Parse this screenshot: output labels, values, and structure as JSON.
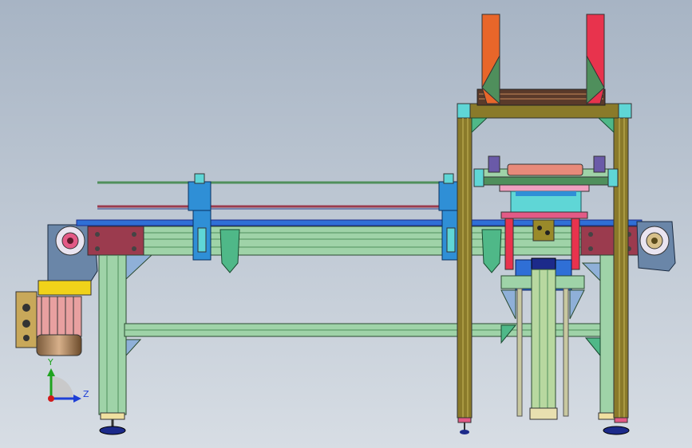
{
  "viewport": {
    "background_top": "#a7b4c4",
    "background_bottom": "#d7dde4"
  },
  "triad": {
    "y_label": "Y",
    "z_label": "Z",
    "y_color": "#1fa31f",
    "z_color": "#1e3fd6",
    "x_color": "#d11a1a"
  },
  "colors": {
    "frame_green": "#9fd3a8",
    "frame_green_dark": "#4f8f5c",
    "olive": "#8a7a2a",
    "plate_maroon": "#9b3b4e",
    "motor_blue": "#6a86a8",
    "bracket_blue": "#2f8fd6",
    "pink": "#e35a86",
    "red": "#e8334d",
    "orange": "#e8662a",
    "cyan": "#5fd6d6",
    "foot_blue": "#1c2a8a",
    "yellow": "#f0d21a"
  }
}
